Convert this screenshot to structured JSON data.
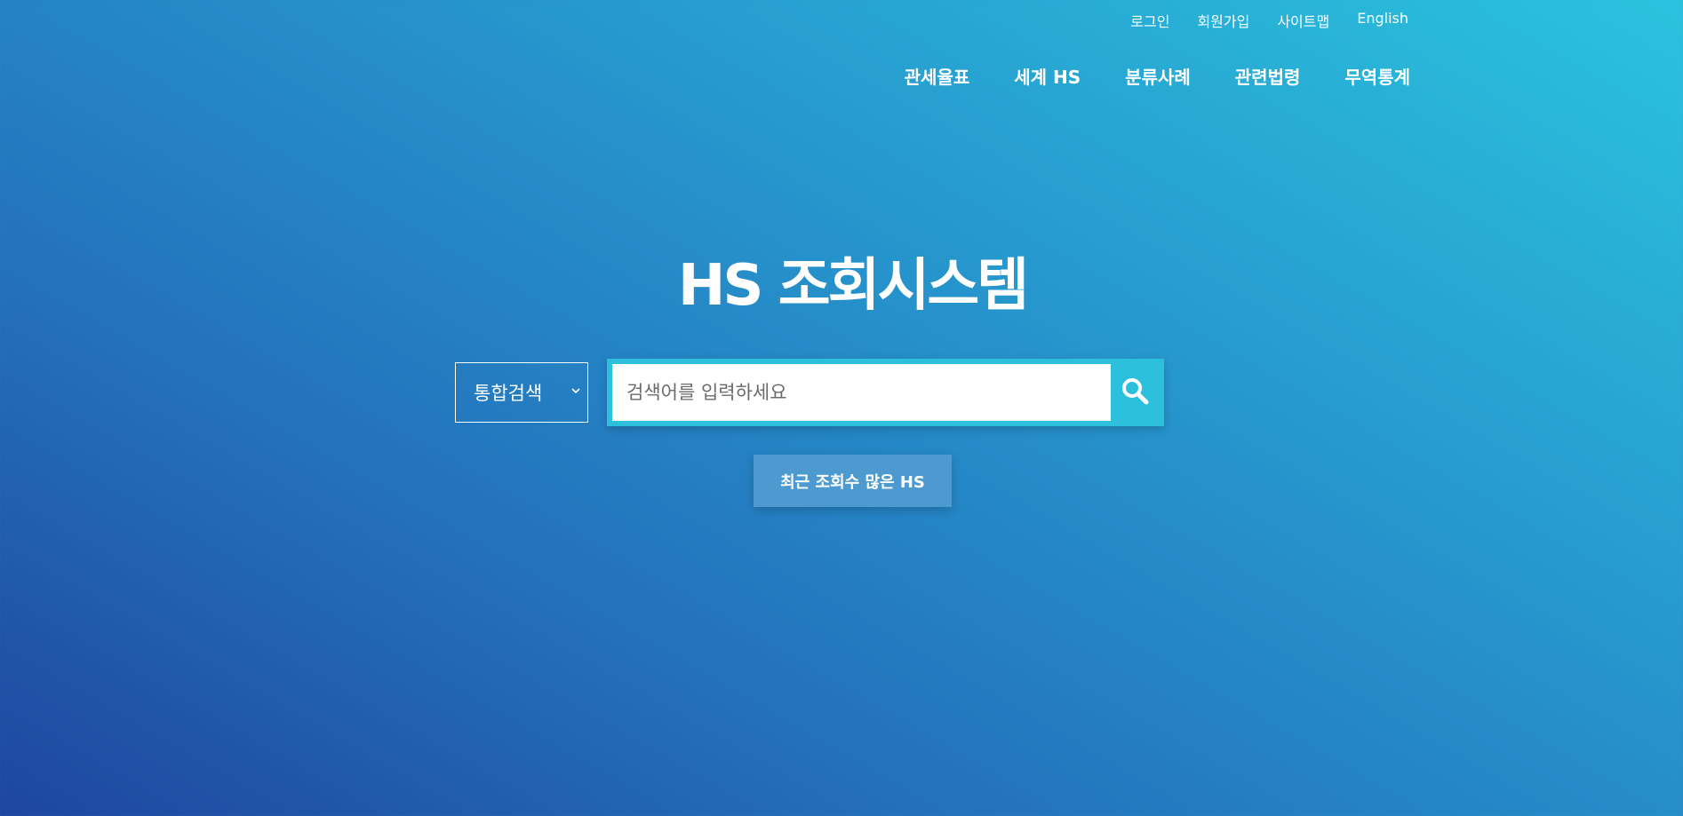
{
  "util_nav": {
    "login": "로그인",
    "signup": "회원가입",
    "sitemap": "사이트맵",
    "english": "English"
  },
  "main_nav": {
    "tariff": "관세율표",
    "world_hs": "세계 HS",
    "classification_cases": "분류사례",
    "related_laws": "관련법령",
    "trade_statistics": "무역통계"
  },
  "title": "HS 조회시스템",
  "search": {
    "select_value": "통합검색",
    "placeholder": "검색어를 입력하세요",
    "icon": "search-icon"
  },
  "popular_button": "최근 조회수 많은 HS",
  "colors": {
    "accent": "#2cc0dc",
    "button": "#4d9ad0",
    "gradient_start": "#1e46a0",
    "gradient_end": "#2ac3de"
  }
}
